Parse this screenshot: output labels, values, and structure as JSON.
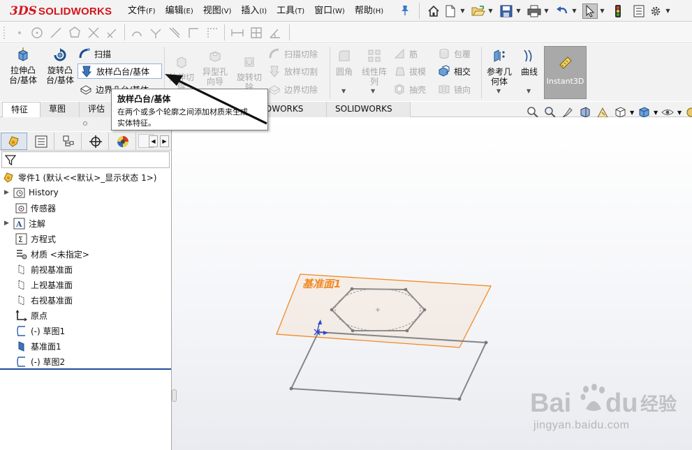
{
  "app": {
    "logo_mark": "3DS",
    "logo_text": "SOLIDWORKS"
  },
  "menu": [
    {
      "label": "文件",
      "key": "(F)"
    },
    {
      "label": "编辑",
      "key": "(E)"
    },
    {
      "label": "视图",
      "key": "(V)"
    },
    {
      "label": "插入",
      "key": "(I)"
    },
    {
      "label": "工具",
      "key": "(T)"
    },
    {
      "label": "窗口",
      "key": "(W)"
    },
    {
      "label": "帮助",
      "key": "(H)"
    }
  ],
  "quick_tools": [
    "home-icon",
    "new-document-icon",
    "open-icon",
    "save-icon",
    "print-icon",
    "undo-icon",
    "select-icon",
    "rebuild-icon",
    "file-properties-icon",
    "options-icon"
  ],
  "features": {
    "extrude_boss": "拉伸凸\n台/基体",
    "revolve_boss": "旋转凸\n台/基体",
    "sweep": "扫描",
    "loft_boss": "放样凸台/基体",
    "boundary_boss": "边界凸台/基体",
    "extrude_cut": "拉伸切\n除",
    "hole_wizard": "异型孔\n向导",
    "revolve_cut": "旋转切\n除",
    "swept_cut": "扫描切除",
    "lofted_cut": "放样切割",
    "boundary_cut": "边界切除",
    "fillet": "圆角",
    "linear_pattern": "线性阵\n列",
    "rib": "筋",
    "draft": "拔模",
    "shell": "抽壳",
    "wrap": "包覆",
    "intersect": "相交",
    "mirror": "镜向",
    "reference_geometry": "参考几\n何体",
    "curves": "曲线",
    "instant3d": "Instant3D"
  },
  "tabs": [
    "特征",
    "草图",
    "评估",
    "DWORKS MBD",
    "SOLIDWORKS CAM"
  ],
  "tooltip": {
    "title": "放样凸台/基体",
    "description": "在两个或多个轮廓之间添加材质来生成实体特征。"
  },
  "panel_tabs": [
    "featuremanager-icon",
    "propertymanager-icon",
    "configurationmanager-icon",
    "dimxpert-icon",
    "display-manager-icon"
  ],
  "tree": [
    {
      "label": "零件1  (默认<<默认>_显示状态 1>)",
      "icon": "part-icon",
      "expandable": false
    },
    {
      "label": "History",
      "icon": "history-icon",
      "expandable": true
    },
    {
      "label": "传感器",
      "icon": "sensor-icon",
      "expandable": false
    },
    {
      "label": "注解",
      "icon": "annotation-icon",
      "expandable": true
    },
    {
      "label": "方程式",
      "icon": "equation-icon",
      "expandable": false
    },
    {
      "label": "材质 <未指定>",
      "icon": "material-icon",
      "expandable": false
    },
    {
      "label": "前视基准面",
      "icon": "plane-icon",
      "expandable": false
    },
    {
      "label": "上视基准面",
      "icon": "plane-icon",
      "expandable": false
    },
    {
      "label": "右视基准面",
      "icon": "plane-icon",
      "expandable": false
    },
    {
      "label": "原点",
      "icon": "origin-icon",
      "expandable": false
    },
    {
      "label": "(-) 草图1",
      "icon": "sketch-icon",
      "expandable": false
    },
    {
      "label": "基准面1",
      "icon": "plane-icon",
      "expandable": false
    },
    {
      "label": "(-) 草图2",
      "icon": "sketch-icon",
      "expandable": false
    }
  ],
  "viewport": {
    "plane_label": "基准面1",
    "plane_color": "#f08a24"
  },
  "watermark": {
    "brand": "Bai",
    "brand2": "du",
    "suffix": "经验",
    "domain": "jingyan.baidu.com"
  }
}
